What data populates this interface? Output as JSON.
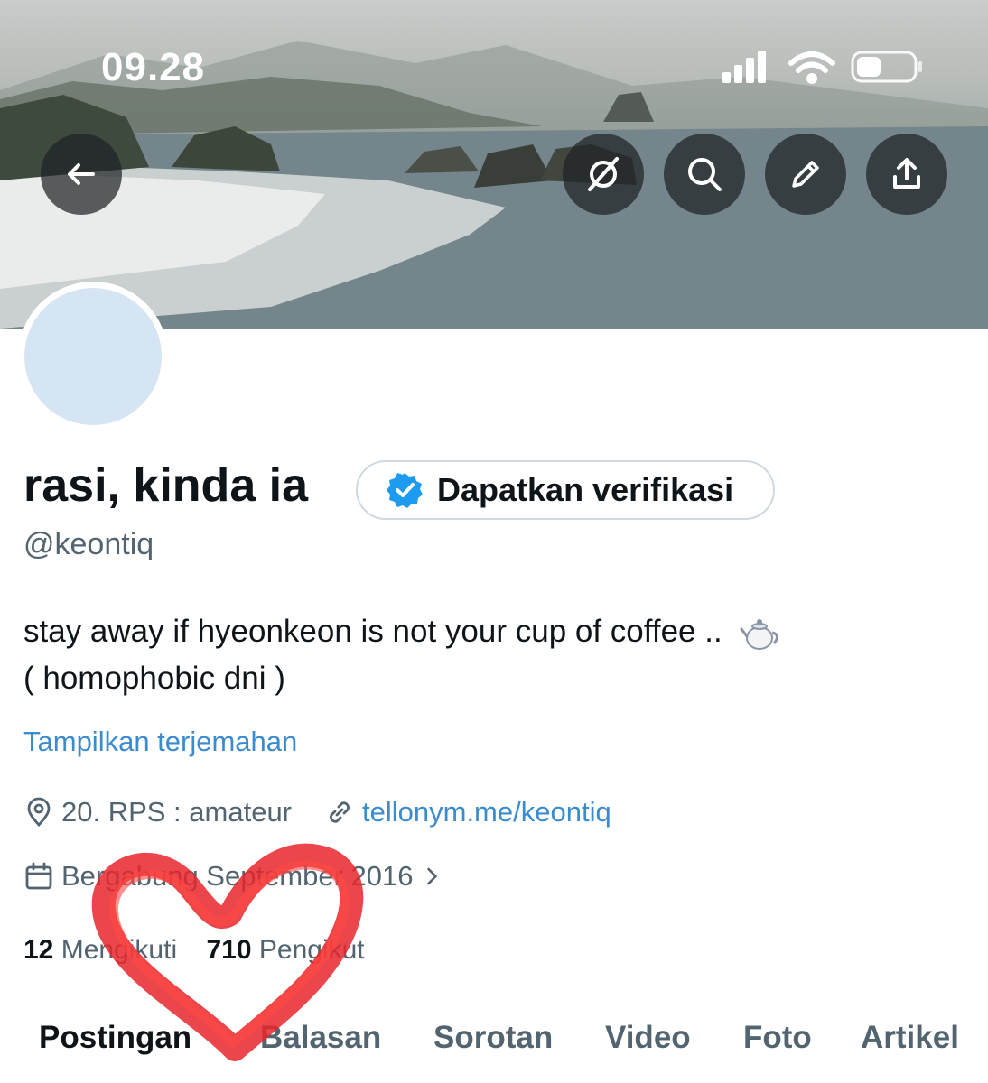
{
  "status_bar": {
    "time": "09.28"
  },
  "header_buttons": {
    "back": "back-arrow-icon",
    "grok": "grok-icon",
    "search": "search-icon",
    "edit": "pencil-icon",
    "share": "share-icon"
  },
  "profile": {
    "display_name": "rasi, kinda ia",
    "verify_label": "Dapatkan verifikasi",
    "handle": "@keontiq",
    "bio_line1": "stay away if hyeonkeon is not your cup of coffee ..",
    "bio_line2": "( homophobic dni )",
    "translate_link": "Tampilkan terjemahan",
    "location": "20. RPS : amateur",
    "website": "tellonym.me/keontiq",
    "joined": "Bergabung September 2016",
    "following_count": "12",
    "following_label": "Mengikuti",
    "followers_count": "710",
    "followers_label": "Pengikut"
  },
  "tabs": [
    {
      "label": "Postingan",
      "active": true
    },
    {
      "label": "Balasan",
      "active": false
    },
    {
      "label": "Sorotan",
      "active": false
    },
    {
      "label": "Video",
      "active": false
    },
    {
      "label": "Foto",
      "active": false
    },
    {
      "label": "Artikel",
      "active": false
    }
  ],
  "colors": {
    "accent": "#1d9bf0",
    "link": "#3b8bcf",
    "muted": "#536471",
    "heart": "#e8262b"
  }
}
